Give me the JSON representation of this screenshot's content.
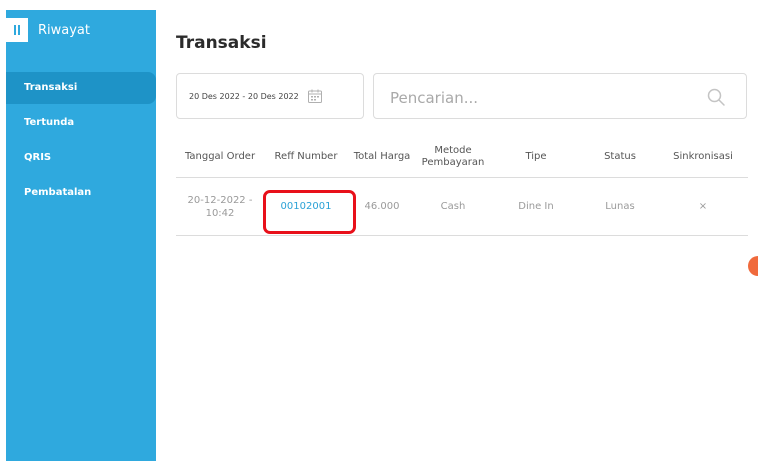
{
  "sidebar": {
    "title": "Riwayat",
    "items": [
      {
        "label": "Transaksi",
        "active": true
      },
      {
        "label": "Tertunda",
        "active": false
      },
      {
        "label": "QRIS",
        "active": false
      },
      {
        "label": "Pembatalan",
        "active": false
      }
    ]
  },
  "main": {
    "title": "Transaksi",
    "date_range": "20 Des 2022 - 20 Des 2022",
    "search": {
      "placeholder": "Pencarian..."
    }
  },
  "table": {
    "headers": {
      "tanggal_order": "Tanggal Order",
      "reff_number": "Reff Number",
      "total_harga": "Total Harga",
      "metode_pembayaran": "Metode Pembayaran",
      "tipe": "Tipe",
      "status": "Status",
      "sinkronisasi": "Sinkronisasi"
    },
    "rows": [
      {
        "tanggal_order": "20-12-2022 - 10:42",
        "reff_number": "00102001",
        "total_harga": "46.000",
        "metode_pembayaran": "Cash",
        "tipe": "Dine In",
        "status": "Lunas",
        "sinkronisasi": "×"
      }
    ]
  },
  "colors": {
    "sidebar": "#2fa9de",
    "sidebar_active": "#1e93c7",
    "link": "#2aa1d6",
    "highlight": "#e8101a"
  }
}
